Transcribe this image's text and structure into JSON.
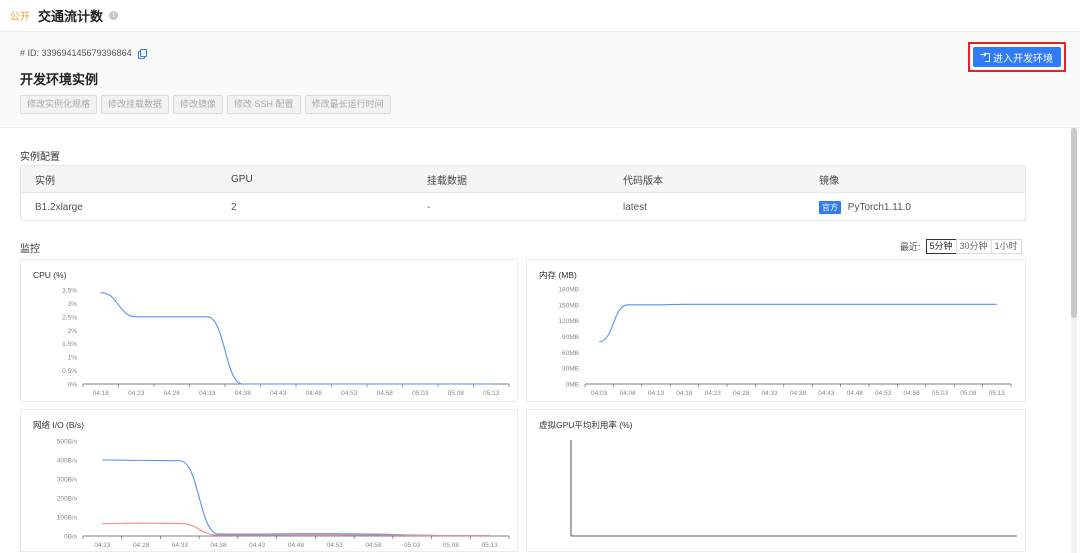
{
  "topbar": {
    "badge": "公开",
    "title": "交通流计数"
  },
  "header": {
    "instance_id": "# ID: 339694145679396864",
    "title": "开发环境实例",
    "actions": [
      "修改实例化规格",
      "修改挂载数据",
      "修改镜像",
      "修改 SSH 配置",
      "修改最长运行时间"
    ],
    "enter_label": "进入开发环境"
  },
  "config": {
    "label": "实例配置",
    "columns": [
      "实例",
      "GPU",
      "挂载数据",
      "代码版本",
      "镜像"
    ],
    "row": [
      "B1.2xlarge",
      "2",
      "-",
      "latest",
      "PyTorch1.11.0"
    ],
    "official_tag": "官方"
  },
  "monitor": {
    "label": "监控",
    "range_label": "最近:",
    "ranges": [
      "5分钟",
      "30分钟",
      "1小时"
    ],
    "active_range": "5分钟"
  },
  "colors": {
    "accent": "#2f7cf6",
    "highlight": "#e22525",
    "series_blue": "#5b8ff9",
    "series_red": "#f08a8a"
  },
  "chart_data": [
    {
      "type": "line",
      "title": "CPU (%)",
      "ylim": [
        0,
        3.5
      ],
      "y_ticks": [
        "0%",
        "0.5%",
        "1%",
        "1.5%",
        "2%",
        "2.5%",
        "3%",
        "3.5%"
      ],
      "x_ticks": [
        "04:18",
        "04:23",
        "04:28",
        "04:33",
        "04:38",
        "04:43",
        "04:48",
        "04:53",
        "04:58",
        "05:03",
        "05:08",
        "05:13"
      ],
      "series": [
        {
          "values": [
            3.4,
            2.5,
            2.5,
            2.5,
            0.0,
            0.0,
            0.0,
            0.0,
            0.0,
            0.0,
            0.0,
            0.0
          ]
        }
      ]
    },
    {
      "type": "line",
      "title": "内存 (MB)",
      "ylim": [
        0,
        180
      ],
      "y_ticks": [
        "0MB",
        "30MB",
        "60MB",
        "90MB",
        "120MB",
        "150MB",
        "180MB"
      ],
      "x_ticks": [
        "04:03",
        "04:08",
        "04:13",
        "04:18",
        "04:23",
        "04:28",
        "04:33",
        "04:38",
        "04:43",
        "04:48",
        "04:53",
        "04:58",
        "05:03",
        "05:08",
        "05:13"
      ],
      "series": [
        {
          "values": [
            80,
            150,
            150,
            151,
            151,
            151,
            151,
            151,
            151,
            151,
            151,
            151,
            151,
            151,
            151
          ]
        }
      ]
    },
    {
      "type": "line",
      "title": "网络 I/O (B/s)",
      "ylim": [
        0,
        500
      ],
      "y_ticks": [
        "0B/s",
        "100B/s",
        "200B/s",
        "300B/s",
        "400B/s",
        "500B/s"
      ],
      "x_ticks": [
        "04:23",
        "04:28",
        "04:33",
        "04:38",
        "04:43",
        "04:48",
        "04:53",
        "04:58",
        "05:03",
        "05:08",
        "05:13"
      ],
      "series": [
        {
          "values": [
            400,
            398,
            396,
            10,
            10,
            12,
            12,
            10,
            5,
            2,
            2
          ]
        },
        {
          "values": [
            65,
            68,
            66,
            5,
            5,
            6,
            6,
            5,
            3,
            2,
            2
          ]
        }
      ]
    },
    {
      "type": "line",
      "title": "虚拟GPU平均利用率 (%)",
      "series": []
    }
  ]
}
